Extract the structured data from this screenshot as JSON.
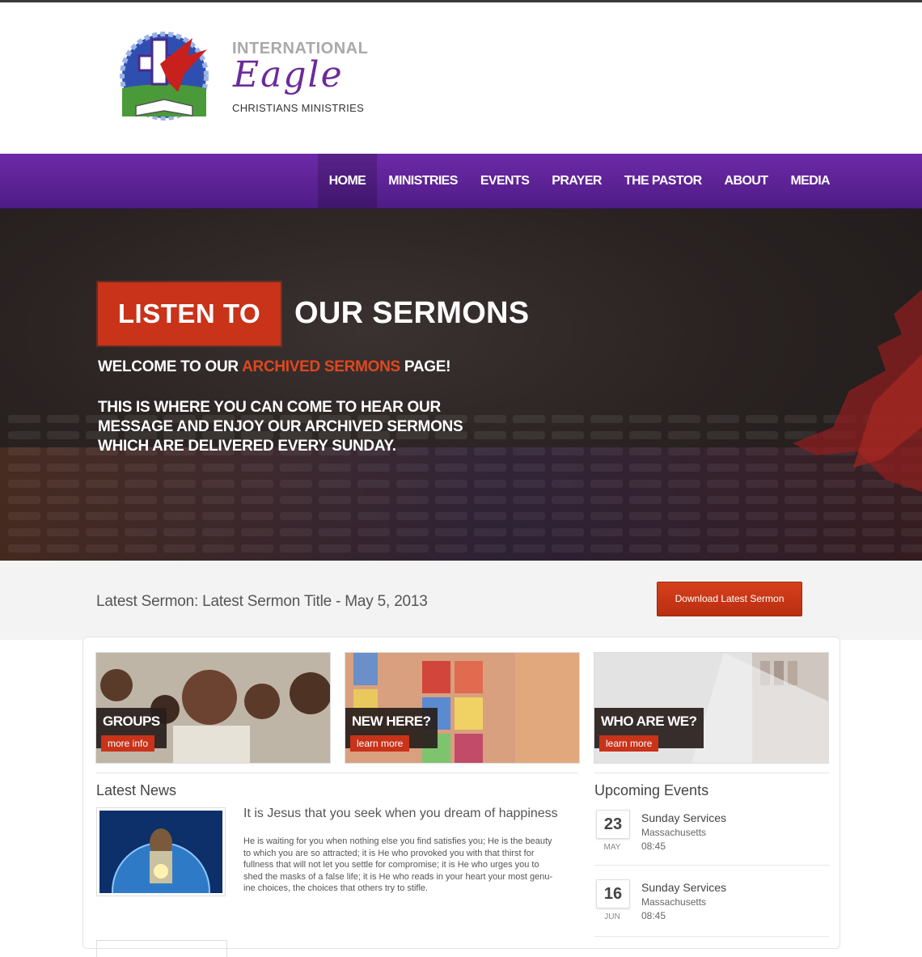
{
  "header": {
    "logo_top": "INTERNATIONAL",
    "logo_script": "Eagle",
    "logo_bottom": "CHRISTIANS MINISTRIES"
  },
  "nav": {
    "items": [
      {
        "label": "HOME",
        "active": true
      },
      {
        "label": "MINISTRIES"
      },
      {
        "label": "EVENTS"
      },
      {
        "label": "PRAYER"
      },
      {
        "label": "THE PASTOR"
      },
      {
        "label": "ABOUT"
      },
      {
        "label": "MEDIA"
      }
    ]
  },
  "hero": {
    "badge": "LISTEN TO",
    "title": "OUR SERMONS",
    "welcome_pre": "WELCOME TO OUR ",
    "welcome_highlight": "ARCHIVED SERMONS",
    "welcome_post": " PAGE!",
    "body": "THIS IS WHERE YOU CAN COME TO HEAR OUR MESSAGE AND ENJOY OUR ARCHIVED SERMONS WHICH ARE DELIVERED EVERY SUNDAY."
  },
  "sermon": {
    "latest": "Latest Sermon: Latest Sermon Title - May 5, 2013",
    "download_label": "Download Latest Sermon"
  },
  "cards": [
    {
      "title": "GROUPS",
      "button": "more info"
    },
    {
      "title": "NEW HERE?",
      "button": "learn more"
    },
    {
      "title": "WHO ARE WE?",
      "button": "learn more"
    }
  ],
  "news": {
    "heading": "Latest News",
    "title": "It is Jesus that you seek when you dream of happiness",
    "body": "He is waiting for you when nothing else you find satisfies you; He is the beauty to which you are so attracted; it is He who provoked you with that thirst for fullness that will not let you settle for compromise; it is He who urges you to shed the masks of a false life; it is He who reads in your heart your most genu-ine choices, the choices that others try to stifle."
  },
  "events": {
    "heading": "Upcoming Events",
    "items": [
      {
        "day": "23",
        "month": "MAY",
        "title": "Sunday Services",
        "location": "Massachusetts",
        "time": "08:45"
      },
      {
        "day": "16",
        "month": "JUN",
        "title": "Sunday Services",
        "location": "Massachusetts",
        "time": "08:45"
      }
    ]
  },
  "colors": {
    "nav_purple": "#5e22a0",
    "accent_red": "#c8331a",
    "hero_dark": "#2a2322"
  }
}
